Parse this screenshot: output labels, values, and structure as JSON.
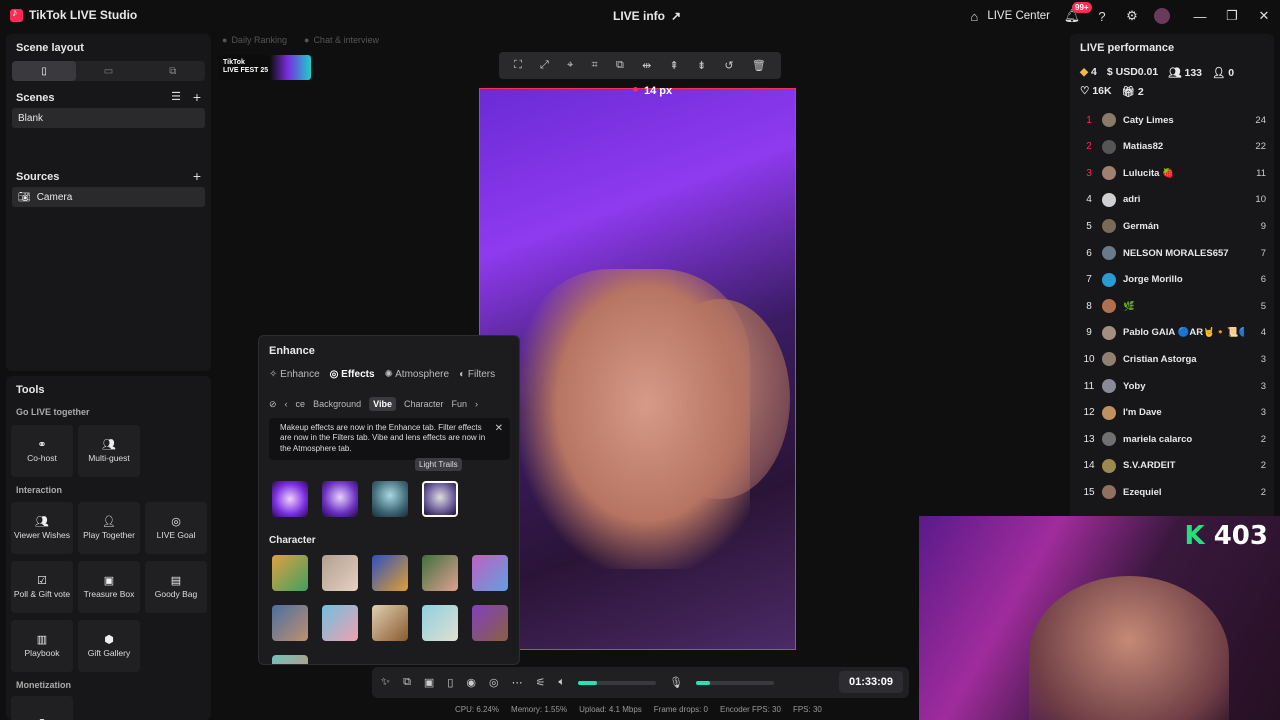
{
  "app": {
    "title": "TikTok LIVE Studio",
    "live_info": "LIVE info",
    "live_center": "LIVE Center",
    "notif_count": "99+"
  },
  "left": {
    "scene_layout": "Scene layout",
    "scenes_title": "Scenes",
    "scenes": [
      "Blank"
    ],
    "sources_title": "Sources",
    "sources": [
      "Camera"
    ]
  },
  "tools": {
    "title": "Tools",
    "go_live_together": "Go LIVE together",
    "cohost": "Co-host",
    "multiguest": "Multi-guest",
    "interaction": "Interaction",
    "viewer_wishes": "Viewer Wishes",
    "play_together": "Play Together",
    "live_goal": "LIVE Goal",
    "poll": "Poll & Gift vote",
    "treasure": "Treasure Box",
    "goody": "Goody Bag",
    "playbook": "Playbook",
    "gift_gallery": "Gift Gallery",
    "monetization": "Monetization"
  },
  "canvas": {
    "daily_ranking": "Daily Ranking",
    "chat_interview": "Chat & interview",
    "fest_line1": "TikTok",
    "fest_line2": "LIVE FEST 25",
    "px_label": "14 px"
  },
  "enhance": {
    "title": "Enhance",
    "tabs": [
      "Enhance",
      "Effects",
      "Atmosphere",
      "Filters"
    ],
    "categories": [
      "ce",
      "Background",
      "Vibe",
      "Character",
      "Fun"
    ],
    "tip": "Makeup effects are now in the Enhance tab. Filter effects are now in the Filters tab. Vibe and lens effects are now in the Atmosphere tab.",
    "tooltip": "Light Trails",
    "character": "Character"
  },
  "bottom": {
    "timer": "01:33:09",
    "mic_level": 0.18,
    "speaker_level": 0.24
  },
  "stats": {
    "cpu": "CPU: 6.24%",
    "memory": "Memory: 1.55%",
    "upload": "Upload: 4.1 Mbps",
    "frame_drops": "Frame drops: 0",
    "encoder_fps": "Encoder FPS: 30",
    "fps": "FPS: 30"
  },
  "performance": {
    "title": "LIVE performance",
    "diamonds": "4",
    "usd": "USD0.01",
    "viewers": "133",
    "new_followers": "0",
    "likes": "16K",
    "gifts": "2",
    "ranking": [
      {
        "rank": "1",
        "name": "Caty Limes",
        "score": "24",
        "color": "#8a7a6a"
      },
      {
        "rank": "2",
        "name": "Matias82",
        "score": "22",
        "color": "#555555"
      },
      {
        "rank": "3",
        "name": "Lulucita 🍓",
        "score": "11",
        "color": "#a08070"
      },
      {
        "rank": "4",
        "name": "adri",
        "score": "10",
        "color": "#d0d0d0"
      },
      {
        "rank": "5",
        "name": "Germán",
        "score": "9",
        "color": "#7a6a5a"
      },
      {
        "rank": "6",
        "name": "NELSON MORALES657",
        "score": "7",
        "color": "#6a7a8a"
      },
      {
        "rank": "7",
        "name": "Jorge Morillo",
        "score": "6",
        "color": "#2a9ad0"
      },
      {
        "rank": "8",
        "name": "🌿",
        "score": "5",
        "color": "#b07050"
      },
      {
        "rank": "9",
        "name": "Pablo GAIA 🔵AR🤘🔸📜🔵",
        "score": "4",
        "color": "#a09080"
      },
      {
        "rank": "10",
        "name": "Cristian Astorga",
        "score": "3",
        "color": "#908070"
      },
      {
        "rank": "11",
        "name": "Yoby",
        "score": "3",
        "color": "#8a8a9a"
      },
      {
        "rank": "12",
        "name": "I'm Dave",
        "score": "3",
        "color": "#c09060"
      },
      {
        "rank": "13",
        "name": "mariela calarco",
        "score": "2",
        "color": "#707070"
      },
      {
        "rank": "14",
        "name": "S.V.ARDEIT",
        "score": "2",
        "color": "#9a8a50"
      },
      {
        "rank": "15",
        "name": "Ezequiel",
        "score": "2",
        "color": "#907060"
      }
    ]
  },
  "pip": {
    "k": "K",
    "count": "403"
  },
  "colors": {
    "accent": "#fe2c55",
    "green": "#22e5b3"
  }
}
